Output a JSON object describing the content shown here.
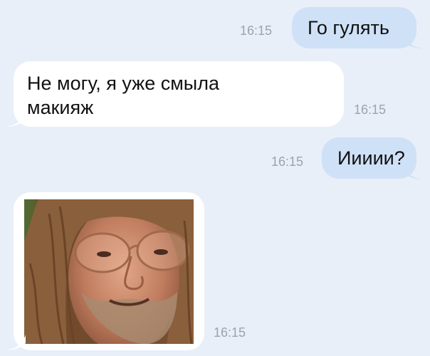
{
  "messages": [
    {
      "direction": "outgoing",
      "text": "Го гулять",
      "time": "16:15"
    },
    {
      "direction": "incoming",
      "text": "Не могу, я уже смыла макияж",
      "time": "16:15"
    },
    {
      "direction": "outgoing",
      "text": "Иииии?",
      "time": "16:15"
    },
    {
      "direction": "incoming",
      "type": "photo",
      "time": "16:15"
    }
  ],
  "colors": {
    "background": "#e8eff8",
    "outgoing_bubble": "#cfe1f7",
    "incoming_bubble": "#ffffff",
    "timestamp": "#9aa4af"
  }
}
